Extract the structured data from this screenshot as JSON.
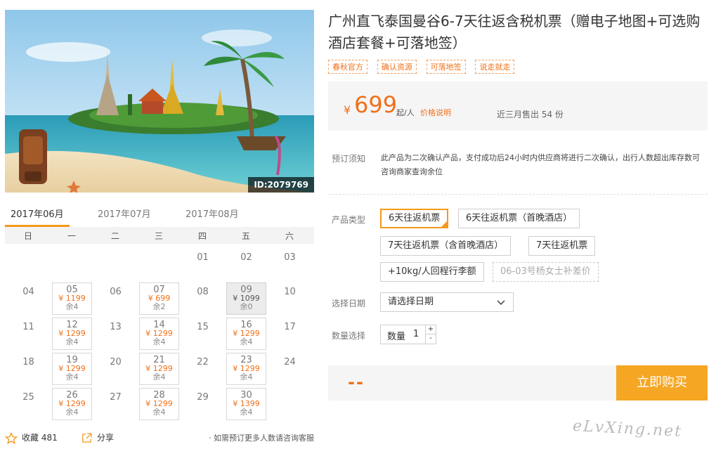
{
  "hero": {
    "photo_id": "ID:2079769"
  },
  "calendar": {
    "months": [
      "2017年06月",
      "2017年07月",
      "2017年08月"
    ],
    "weekdays": [
      "日",
      "一",
      "二",
      "三",
      "四",
      "五",
      "六"
    ],
    "days": [
      {
        "num": "01",
        "col": 4,
        "row": 0
      },
      {
        "num": "02",
        "col": 5,
        "row": 0
      },
      {
        "num": "03",
        "col": 6,
        "row": 0
      },
      {
        "num": "04",
        "col": 0,
        "row": 1
      },
      {
        "num": "05",
        "col": 1,
        "row": 1,
        "price": "¥ 1199",
        "left": "余4"
      },
      {
        "num": "06",
        "col": 2,
        "row": 1
      },
      {
        "num": "07",
        "col": 3,
        "row": 1,
        "price": "¥ 699",
        "left": "余2"
      },
      {
        "num": "08",
        "col": 4,
        "row": 1
      },
      {
        "num": "09",
        "col": 5,
        "row": 1,
        "price": "¥ 1099",
        "left": "余0",
        "soldout": true
      },
      {
        "num": "10",
        "col": 6,
        "row": 1
      },
      {
        "num": "11",
        "col": 0,
        "row": 2
      },
      {
        "num": "12",
        "col": 1,
        "row": 2,
        "price": "¥ 1299",
        "left": "余4"
      },
      {
        "num": "13",
        "col": 2,
        "row": 2
      },
      {
        "num": "14",
        "col": 3,
        "row": 2,
        "price": "¥ 1299",
        "left": "余4"
      },
      {
        "num": "15",
        "col": 4,
        "row": 2
      },
      {
        "num": "16",
        "col": 5,
        "row": 2,
        "price": "¥ 1299",
        "left": "余4"
      },
      {
        "num": "17",
        "col": 6,
        "row": 2
      },
      {
        "num": "18",
        "col": 0,
        "row": 3
      },
      {
        "num": "19",
        "col": 1,
        "row": 3,
        "price": "¥ 1299",
        "left": "余4"
      },
      {
        "num": "20",
        "col": 2,
        "row": 3
      },
      {
        "num": "21",
        "col": 3,
        "row": 3,
        "price": "¥ 1299",
        "left": "余4"
      },
      {
        "num": "22",
        "col": 4,
        "row": 3
      },
      {
        "num": "23",
        "col": 5,
        "row": 3,
        "price": "¥ 1299",
        "left": "余4"
      },
      {
        "num": "24",
        "col": 6,
        "row": 3
      },
      {
        "num": "25",
        "col": 0,
        "row": 4
      },
      {
        "num": "26",
        "col": 1,
        "row": 4,
        "price": "¥ 1299",
        "left": "余4"
      },
      {
        "num": "27",
        "col": 2,
        "row": 4
      },
      {
        "num": "28",
        "col": 3,
        "row": 4,
        "price": "¥ 1299",
        "left": "余4"
      },
      {
        "num": "29",
        "col": 4,
        "row": 4
      },
      {
        "num": "30",
        "col": 5,
        "row": 4,
        "price": "¥ 1399",
        "left": "余4"
      }
    ]
  },
  "footer": {
    "fav_label": "收藏",
    "fav_count": "481",
    "share_label": "分享",
    "tip": "· 如需预订更多人数请咨询客服"
  },
  "product": {
    "title": "广州直飞泰国曼谷6-7天往返含税机票（赠电子地图+可选购酒店套餐+可落地签）",
    "tags": [
      "春秋官方",
      "确认资源",
      "可落地签",
      "说走就走"
    ],
    "yen": "¥",
    "price": "699",
    "per": "起/人",
    "price_note": "价格说明",
    "sold": "近三月售出 54 份",
    "notice_label": "预订须知",
    "notice": "此产品为二次确认产品，支付成功后24小时内供应商将进行二次确认，出行人数超出库存数可咨询商家查询余位",
    "type_label": "产品类型",
    "types": [
      "6天往返机票",
      "6天往返机票（首晚酒店）",
      "7天往返机票（含首晚酒店）",
      "7天往返机票",
      "+10kg/人回程行李额",
      "06-03号杨女士补差价"
    ],
    "date_label": "选择日期",
    "date_placeholder": "请选择日期",
    "qty_label": "数量选择",
    "qty_inner_label": "数量",
    "qty_value": "1",
    "plus": "+",
    "minus": "-",
    "total": "--",
    "buy": "立即购买"
  },
  "watermark": "eLvXing.net",
  "colors": {
    "accent": "#f0701a",
    "button": "#f5a623",
    "selected_border": "#f39a1b"
  }
}
